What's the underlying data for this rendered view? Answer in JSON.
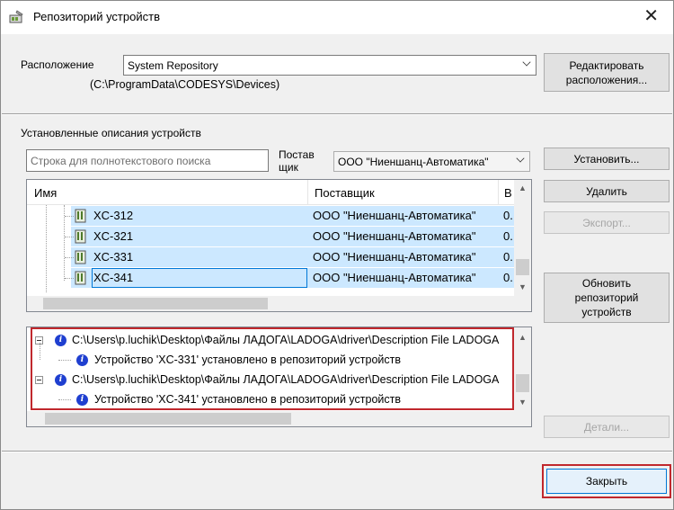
{
  "window": {
    "title": "Репозиторий устройств",
    "close_glyph": "✕"
  },
  "location": {
    "label": "Расположение",
    "selected": "System Repository",
    "path": "(C:\\ProgramData\\CODESYS\\Devices)",
    "edit_button": "Редактировать расположения..."
  },
  "installed": {
    "label": "Установленные описания устройств",
    "search_placeholder": "Строка для полнотекстового поиска",
    "vendor_label_line1": "Постав",
    "vendor_label_line2": "щик",
    "vendor_selected": "ООО \"Ниеншанц-Автоматика\""
  },
  "list": {
    "columns": [
      "Имя",
      "Поставщик",
      "В"
    ],
    "rows": [
      {
        "name": "XC-312",
        "vendor": "ООО \"Ниеншанц-Автоматика\"",
        "version": "0."
      },
      {
        "name": "XC-321",
        "vendor": "ООО \"Ниеншанц-Автоматика\"",
        "version": "0."
      },
      {
        "name": "XC-331",
        "vendor": "ООО \"Ниеншанц-Автоматика\"",
        "version": "0."
      },
      {
        "name": "XC-341",
        "vendor": "ООО \"Ниеншанц-Автоматика\"",
        "version": "0."
      }
    ]
  },
  "log": {
    "entries": [
      {
        "path": "C:\\Users\\p.luchik\\Desktop\\Файлы ЛАДОГА\\LADOGA\\driver\\Description File LADOGA",
        "message": "Устройство 'XC-331' установлено в репозиторий устройств"
      },
      {
        "path": "C:\\Users\\p.luchik\\Desktop\\Файлы ЛАДОГА\\LADOGA\\driver\\Description File LADOGA",
        "message": "Устройство 'XC-341' установлено в репозиторий устройств"
      }
    ]
  },
  "buttons": {
    "install": "Установить...",
    "delete": "Удалить",
    "export": "Экспорт...",
    "refresh": "Обновить репозиторий устройств",
    "details": "Детали...",
    "close": "Закрыть"
  },
  "colors": {
    "selection": "#cce8ff",
    "highlight_border": "#c0282d",
    "info_icon": "#1f3fd0"
  },
  "icons": {
    "title": "device-repository-icon",
    "device": "device-module-icon",
    "info": "info-icon"
  }
}
